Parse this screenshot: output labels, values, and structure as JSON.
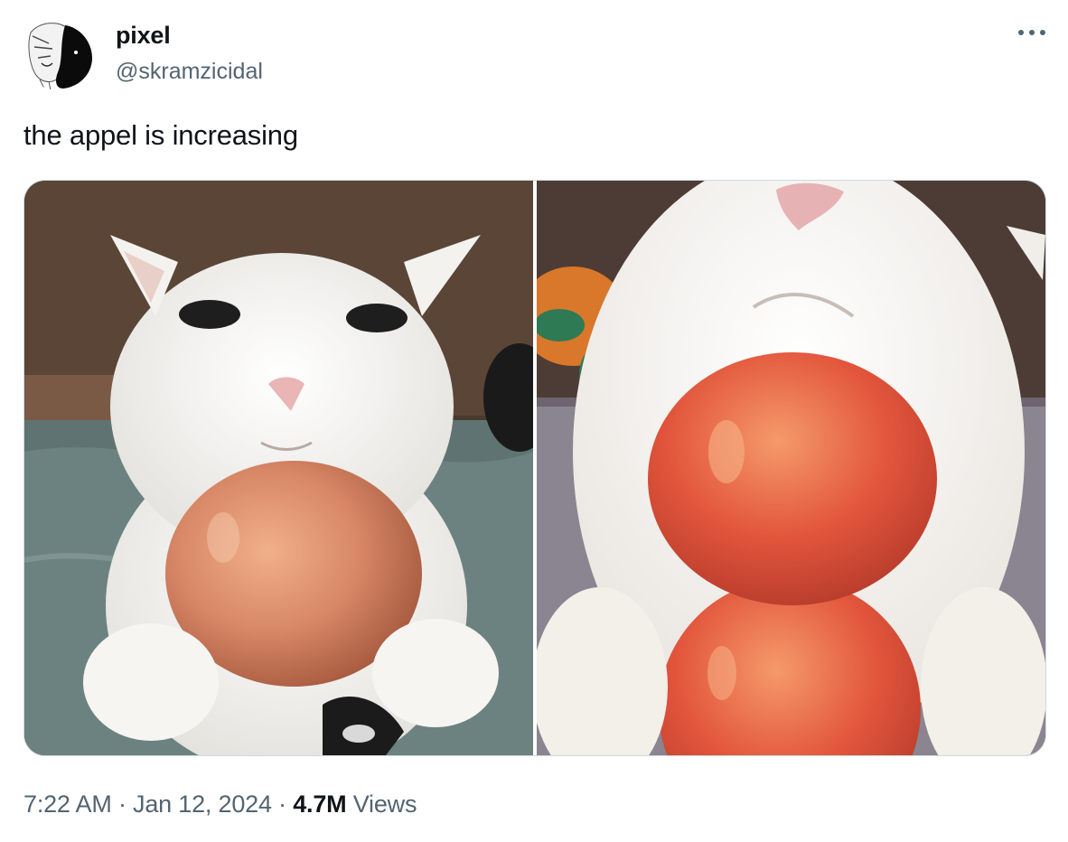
{
  "tweet": {
    "author": {
      "display_name": "pixel",
      "handle": "@skramzicidal",
      "avatar_icon": "avatar-illustration-icon"
    },
    "more_icon": "more-options-icon",
    "text": "the appel is increasing",
    "media": [
      {
        "name": "photo-cat-one-apple",
        "icon": "cat-with-one-apple-photo"
      },
      {
        "name": "photo-cat-two-apples",
        "icon": "cat-with-two-apples-photo"
      }
    ],
    "timestamp": "7:22 AM · Jan 12, 2024",
    "separator": " · ",
    "views_count": "4.7M",
    "views_label": " Views"
  },
  "colors": {
    "text_primary": "#0f1419",
    "text_secondary": "#536471",
    "media_border": "#cfd9de"
  }
}
